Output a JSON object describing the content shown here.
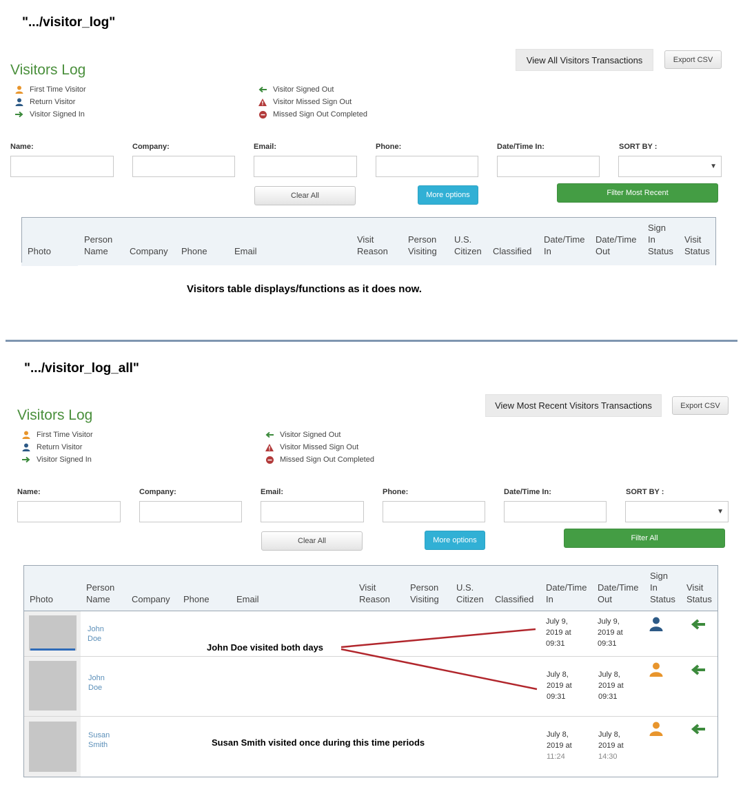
{
  "colors": {
    "title_green": "#4a8f3c",
    "first_time_orange": "#e8952c",
    "return_blue": "#2d5a86",
    "signed_green": "#3c8a3c",
    "missed_red": "#b23a3a",
    "filter_green": "#449d44",
    "more_blue": "#31b0d5",
    "annotation_red": "#b1262c"
  },
  "legend": {
    "left": [
      {
        "icon": "person-orange-icon",
        "label": "First Time Visitor"
      },
      {
        "icon": "person-blue-icon",
        "label": "Return Visitor"
      },
      {
        "icon": "arrow-right-green-icon",
        "label": "Visitor Signed In"
      }
    ],
    "right": [
      {
        "icon": "arrow-left-green-icon",
        "label": "Visitor Signed Out"
      },
      {
        "icon": "warning-triangle-icon",
        "label": "Visitor Missed Sign Out"
      },
      {
        "icon": "circle-minus-icon",
        "label": "Missed Sign Out Completed"
      }
    ]
  },
  "filters": {
    "name_label": "Name:",
    "company_label": "Company:",
    "email_label": "Email:",
    "phone_label": "Phone:",
    "datetime_label": "Date/Time In:",
    "sortby_label": "SORT BY :",
    "select_caret": "▼",
    "clear_all": "Clear All",
    "more_options": "More options"
  },
  "table_headers": {
    "photo": "Photo",
    "person_name": [
      "Person",
      "Name"
    ],
    "company": "Company",
    "phone": "Phone",
    "email": "Email",
    "visit_reason": [
      "Visit",
      "Reason"
    ],
    "person_visiting": [
      "Person",
      "Visiting"
    ],
    "us_citizen": [
      "U.S.",
      "Citizen"
    ],
    "classified": "Classified",
    "datetime_in": [
      "Date/Time",
      "In"
    ],
    "datetime_out": [
      "Date/Time",
      "Out"
    ],
    "sign_in_status": [
      "Sign",
      "In",
      "Status"
    ],
    "visit_status": [
      "Visit",
      "Status"
    ]
  },
  "section1": {
    "url": "\".../visitor_log\"",
    "title": "Visitors Log",
    "view_button": "View All Visitors Transactions",
    "export_button": "Export CSV",
    "filter_button": "Filter Most Recent",
    "note": "Visitors table displays/functions as it does now."
  },
  "section2": {
    "url": "\".../visitor_log_all\"",
    "title": "Visitors Log",
    "view_button": "View Most Recent Visitors Transactions",
    "export_button": "Export CSV",
    "filter_button": "Filter All",
    "rows": [
      {
        "name": [
          "John",
          "Doe"
        ],
        "date_in": [
          "July 9,",
          "2019 at",
          "09:31"
        ],
        "date_out": [
          "July 9,",
          "2019 at",
          "09:31"
        ],
        "sign_in_icon": "person-blue-icon",
        "visit_icon": "arrow-left-green-icon"
      },
      {
        "name": [
          "John",
          "Doe"
        ],
        "date_in": [
          "July 8,",
          "2019 at",
          "09:31"
        ],
        "date_out": [
          "July 8,",
          "2019 at",
          "09:31"
        ],
        "sign_in_icon": "person-orange-icon",
        "visit_icon": "arrow-left-green-icon"
      },
      {
        "name": [
          "Susan",
          "Smith"
        ],
        "date_in": [
          "July 8,",
          "2019 at",
          "11:24"
        ],
        "date_out": [
          "July 8,",
          "2019 at",
          "14:30"
        ],
        "sign_in_icon": "person-orange-icon",
        "visit_icon": "arrow-left-green-icon"
      }
    ],
    "annotation_john": "John Doe visited both days",
    "annotation_susan": "Susan Smith visited once during this time periods"
  }
}
